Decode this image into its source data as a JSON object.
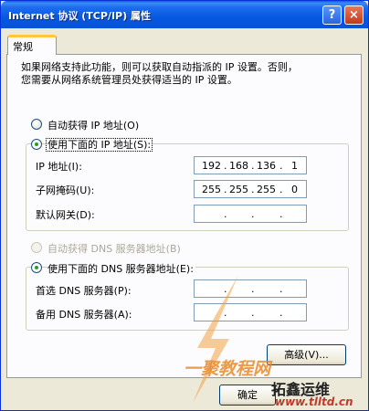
{
  "window": {
    "title": "Internet 协议 (TCP/IP) 属性",
    "help_label": "?",
    "close_label": "×"
  },
  "tabs": [
    {
      "label": "常规"
    }
  ],
  "intro": {
    "line1": "如果网络支持此功能，则可以获取自动指派的 IP 设置。否则，",
    "line2": "您需要从网络系统管理员处获得适当的 IP 设置。"
  },
  "ip_mode": {
    "auto": {
      "label": "自动获得 IP 地址(O)",
      "checked": false
    },
    "manual": {
      "label": "使用下面的 IP 地址(S):",
      "checked": true
    }
  },
  "ip_fields": [
    {
      "label": "IP 地址(I):",
      "octets": [
        "192",
        "168",
        "136",
        "1"
      ]
    },
    {
      "label": "子网掩码(U):",
      "octets": [
        "255",
        "255",
        "255",
        "0"
      ]
    },
    {
      "label": "默认网关(D):",
      "octets": [
        "",
        "",
        "",
        ""
      ]
    }
  ],
  "dns_mode": {
    "auto": {
      "label": "自动获得 DNS 服务器地址(B)",
      "checked": false,
      "disabled": true
    },
    "manual": {
      "label": "使用下面的 DNS 服务器地址(E):",
      "checked": true
    }
  },
  "dns_fields": [
    {
      "label": "首选 DNS 服务器(P):",
      "octets": [
        "",
        "",
        "",
        ""
      ]
    },
    {
      "label": "备用 DNS 服务器(A):",
      "octets": [
        "",
        "",
        "",
        ""
      ]
    }
  ],
  "buttons": {
    "advanced": "高级(V)...",
    "ok": "确定"
  },
  "watermark": {
    "text1": "一聚教程网",
    "text2": "拓鑫运维",
    "text3": "www.tlltd.cn"
  },
  "colors": {
    "titlebar": "#0558e0",
    "tab_highlight": "#ffc83c",
    "radio_dot": "#21a121"
  }
}
